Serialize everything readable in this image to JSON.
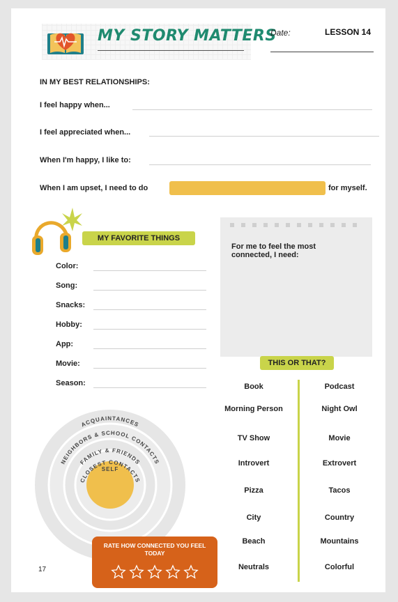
{
  "header": {
    "title": "MY STORY MATTERS",
    "date_label": "Date:",
    "lesson": "LESSON 14"
  },
  "relationships": {
    "heading": "IN MY BEST RELATIONSHIPS:",
    "prompts": [
      "I feel happy when...",
      "I feel appreciated when...",
      "When I'm happy, I like to:"
    ],
    "upset_before": "When I am upset, I need to do",
    "upset_after": "for myself."
  },
  "favorites": {
    "heading": "MY FAVORITE THINGS",
    "items": [
      "Color:",
      "Song:",
      "Snacks:",
      "Hobby:",
      "App:",
      "Movie:",
      "Season:"
    ]
  },
  "note": {
    "text": "For me to feel the most connected, I need:"
  },
  "this_or_that": {
    "heading": "THIS OR THAT?",
    "pairs": [
      [
        "Book",
        "Podcast"
      ],
      [
        "Morning Person",
        "Night Owl"
      ],
      [
        "TV Show",
        "Movie"
      ],
      [
        "Introvert",
        "Extrovert"
      ],
      [
        "Pizza",
        "Tacos"
      ],
      [
        "City",
        "Country"
      ],
      [
        "Beach",
        "Mountains"
      ],
      [
        "Neutrals",
        "Colorful"
      ]
    ]
  },
  "circles": {
    "rings": [
      "ACQUAINTANCES",
      "NEIGHBORS & SCHOOL CONTACTS",
      "FAMILY & FRIENDS",
      "CLOSEST CONTACTS"
    ],
    "center": "SELF"
  },
  "rating": {
    "label": "RATE HOW CONNECTED YOU FEEL TODAY",
    "stars_total": 5,
    "stars_filled": 0
  },
  "page_number": "17",
  "colors": {
    "accent_green": "#1f8a6f",
    "highlight_yellow": "#f0bf4c",
    "pill_green": "#c9d44a",
    "rating_orange": "#d6621a",
    "heart_orange": "#e2552a"
  }
}
